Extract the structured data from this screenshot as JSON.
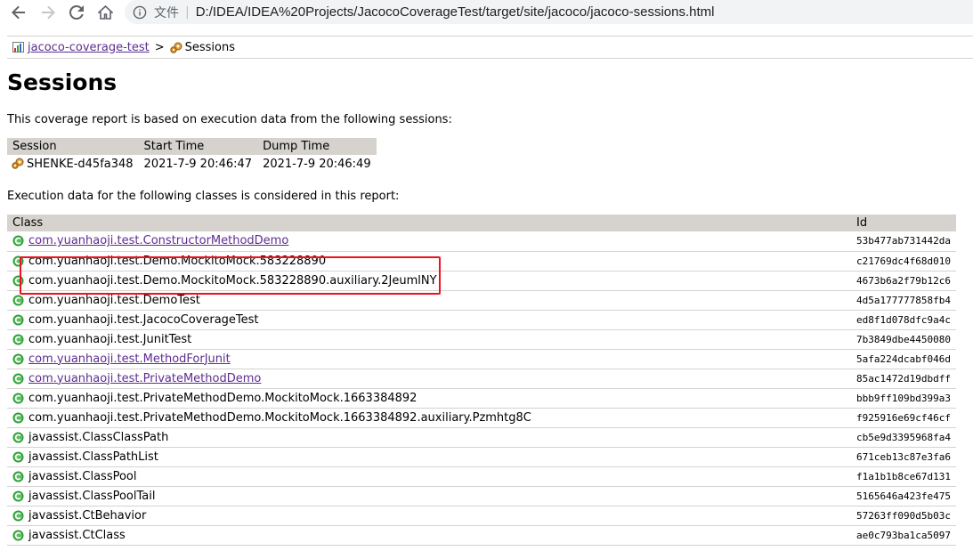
{
  "browser": {
    "scheme_label": "文件",
    "url": "D:/IDEA/IDEA%20Projects/JacocoCoverageTest/target/site/jacoco/jacoco-sessions.html"
  },
  "breadcrumb": {
    "report_link": "jacoco-coverage-test",
    "separator": ">",
    "current": "Sessions"
  },
  "heading": "Sessions",
  "intro_text": "This coverage report is based on execution data from the following sessions:",
  "sessions_table": {
    "headers": [
      "Session",
      "Start Time",
      "Dump Time"
    ],
    "rows": [
      {
        "session": "SHENKE-d45fa348",
        "start": "2021-7-9 20:46:47",
        "dump": "2021-7-9 20:46:49"
      }
    ]
  },
  "classes_text": "Execution data for the following classes is considered in this report:",
  "classes_table": {
    "headers": [
      "Class",
      "Id"
    ],
    "rows": [
      {
        "name": "com.yuanhaoji.test.ConstructorMethodDemo",
        "id": "53b477ab731442da",
        "link": true
      },
      {
        "name": "com.yuanhaoji.test.Demo.MockitoMock.583228890",
        "id": "c21769dc4f68d010",
        "link": false
      },
      {
        "name": "com.yuanhaoji.test.Demo.MockitoMock.583228890.auxiliary.2JeumlNY",
        "id": "4673b6a2f79b12c6",
        "link": false
      },
      {
        "name": "com.yuanhaoji.test.DemoTest",
        "id": "4d5a177777858fb4",
        "link": false
      },
      {
        "name": "com.yuanhaoji.test.JacocoCoverageTest",
        "id": "ed8f1d078dfc9a4c",
        "link": false
      },
      {
        "name": "com.yuanhaoji.test.JunitTest",
        "id": "7b3849dbe4450080",
        "link": false
      },
      {
        "name": "com.yuanhaoji.test.MethodForJunit",
        "id": "5afa224dcabf046d",
        "link": true
      },
      {
        "name": "com.yuanhaoji.test.PrivateMethodDemo",
        "id": "85ac1472d19dbdff",
        "link": true
      },
      {
        "name": "com.yuanhaoji.test.PrivateMethodDemo.MockitoMock.1663384892",
        "id": "bbb9ff109bd399a3",
        "link": false
      },
      {
        "name": "com.yuanhaoji.test.PrivateMethodDemo.MockitoMock.1663384892.auxiliary.Pzmhtg8C",
        "id": "f925916e69cf46cf",
        "link": false
      },
      {
        "name": "javassist.ClassClassPath",
        "id": "cb5e9d3395968fa4",
        "link": false
      },
      {
        "name": "javassist.ClassPathList",
        "id": "671ceb13c87e3fa6",
        "link": false
      },
      {
        "name": "javassist.ClassPool",
        "id": "f1a1b1b8ce67d131",
        "link": false
      },
      {
        "name": "javassist.ClassPoolTail",
        "id": "5165646a423fe475",
        "link": false
      },
      {
        "name": "javassist.CtBehavior",
        "id": "57263ff090d5b03c",
        "link": false
      },
      {
        "name": "javassist.CtClass",
        "id": "ae0c793ba1ca5097",
        "link": false
      }
    ]
  },
  "colors": {
    "link": "#5e2d91",
    "table_header_bg": "#d6d3ce",
    "class_icon": "#2e9a3a",
    "highlight_border": "#e11122"
  },
  "icons": {
    "back": "arrow-left-icon",
    "forward": "arrow-right-icon",
    "reload": "reload-icon",
    "home": "home-icon",
    "info": "info-icon",
    "report": "report-icon",
    "session": "session-gears-icon",
    "class": "class-green-icon"
  }
}
